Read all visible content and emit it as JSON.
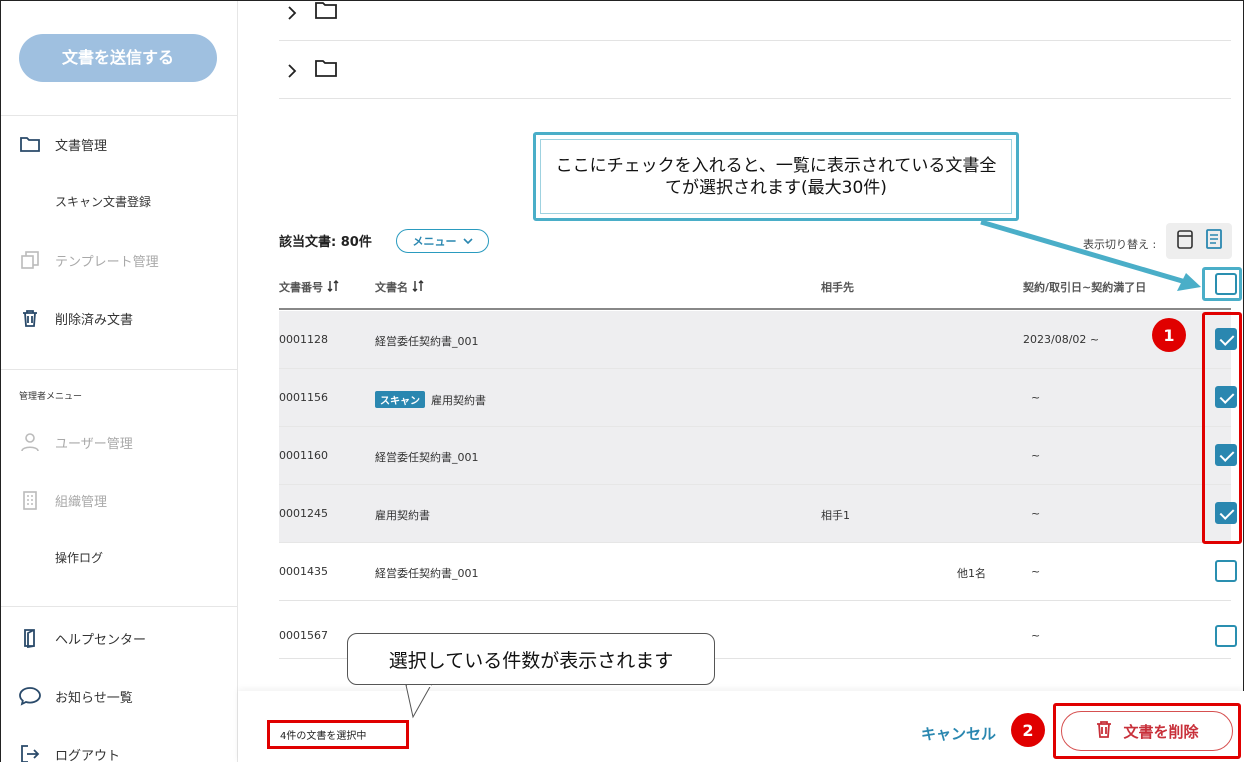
{
  "sidebar": {
    "send_button": "文書を送信する",
    "items": [
      {
        "label": "文書管理"
      },
      {
        "label": "スキャン文書登録"
      },
      {
        "label": "テンプレート管理"
      },
      {
        "label": "削除済み文書"
      },
      {
        "label": "ユーザー管理"
      },
      {
        "label": "組織管理"
      },
      {
        "label": "操作ログ"
      },
      {
        "label": "ヘルプセンター"
      },
      {
        "label": "お知らせ一覧"
      },
      {
        "label": "ログアウト"
      }
    ],
    "admin_section": "管理者メニュー"
  },
  "list": {
    "count_label": "該当文書: 80件",
    "menu_label": "メニュー",
    "view_switch_label": "表示切り替え :",
    "columns": {
      "doc_no": "文書番号",
      "doc_name": "文書名",
      "partner": "相手先",
      "date": "契約/取引日~契約満了日"
    },
    "rows": [
      {
        "no": "0001128",
        "tag": "",
        "name": "経営委任契約書_001",
        "partner": "",
        "extra": "",
        "date": "2023/08/02 ~",
        "checked": true
      },
      {
        "no": "0001156",
        "tag": "スキャン",
        "name": "雇用契約書",
        "partner": "",
        "extra": "",
        "date": "~",
        "checked": true
      },
      {
        "no": "0001160",
        "tag": "",
        "name": "経営委任契約書_001",
        "partner": "",
        "extra": "",
        "date": "~",
        "checked": true
      },
      {
        "no": "0001245",
        "tag": "",
        "name": "雇用契約書",
        "partner": "相手1",
        "extra": "",
        "date": "~",
        "checked": true
      },
      {
        "no": "0001435",
        "tag": "",
        "name": "経営委任契約書_001",
        "partner": "",
        "extra": "他1名",
        "date": "~",
        "checked": false
      },
      {
        "no": "0001567",
        "tag": "",
        "name": "",
        "partner": "",
        "extra": "",
        "date": "~",
        "checked": false
      }
    ]
  },
  "footer": {
    "selected_count": "4件の文書を選択中",
    "cancel_label": "キャンセル",
    "delete_label": "文書を削除"
  },
  "annotations": {
    "select_all_callout": "ここにチェックを入れると、一覧に表示されている文書全てが選択されます(最大30件)",
    "count_callout": "選択している件数が表示されます",
    "badge1": "1",
    "badge2": "2"
  },
  "colors": {
    "accent": "#2a87b0",
    "highlight_red": "#e00000",
    "callout_blue": "#4aaec8",
    "send_button": "#9fc0e0"
  }
}
